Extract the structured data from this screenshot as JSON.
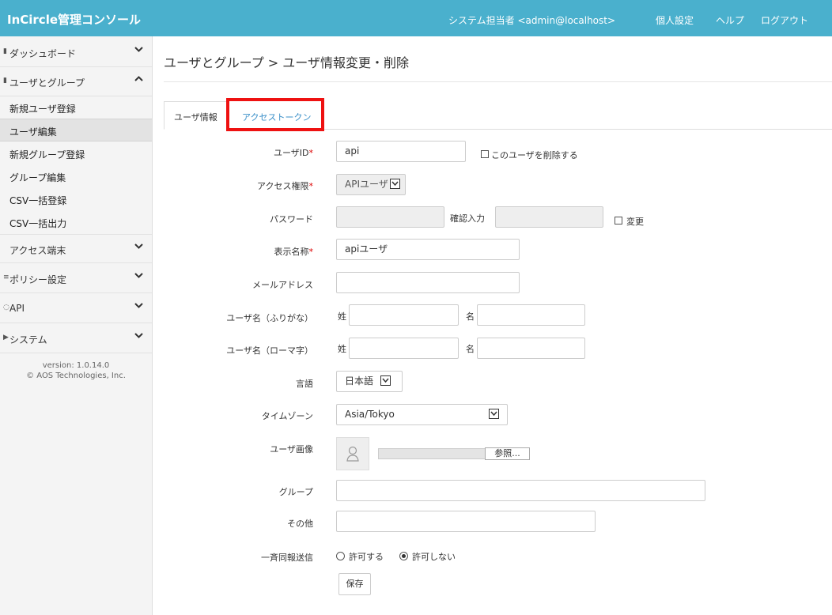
{
  "header": {
    "brand": "InCircle管理コンソール",
    "user": "システム担当者 <admin@localhost>",
    "nav": [
      "個人設定",
      "ヘルプ",
      "ログアウト"
    ]
  },
  "sidebar": {
    "sections": [
      {
        "label": "ダッシュボード",
        "icon": "chart-icon",
        "expanded": false
      },
      {
        "label": "ユーザとグループ",
        "icon": "user-icon",
        "expanded": true
      },
      {
        "label": "アクセス端末",
        "icon": "device-icon",
        "expanded": false
      },
      {
        "label": "ポリシー設定",
        "icon": "list-icon",
        "expanded": false
      },
      {
        "label": "API",
        "icon": "api-icon",
        "expanded": false
      },
      {
        "label": "システム",
        "icon": "play-icon",
        "expanded": false
      }
    ],
    "items": [
      "新規ユーザ登録",
      "ユーザ編集",
      "新規グループ登録",
      "グループ編集",
      "CSV一括登録",
      "CSV一括出力"
    ],
    "active_item": "ユーザ編集",
    "version": "version: 1.0.14.0",
    "copyright": "© AOS Technologies, Inc."
  },
  "page": {
    "title": "ユーザとグループ > ユーザ情報変更・削除",
    "tabs": [
      "ユーザ情報",
      "アクセストークン"
    ]
  },
  "form": {
    "user_id_label": "ユーザID",
    "required_mark": "*",
    "user_id_value": "api",
    "delete_label": "このユーザを削除する",
    "access_label": "アクセス権限",
    "access_value": "APIユーザ",
    "password_label": "パスワード",
    "confirm_label": "確認入力",
    "change_label": "変更",
    "display_label": "表示名称",
    "display_value": "apiユーザ",
    "email_label": "メールアドレス",
    "name_kana_label": "ユーザ名（ふりがな）",
    "name_roma_label": "ユーザ名（ローマ字）",
    "last_label": "姓",
    "first_label": "名",
    "lang_label": "言語",
    "lang_value": "日本語",
    "tz_label": "タイムゾーン",
    "tz_value": "Asia/Tokyo",
    "image_label": "ユーザ画像",
    "browse_label": "参照...",
    "group_label": "グループ",
    "other_label": "その他",
    "broadcast_label": "一斉同報送信",
    "allow_label": "許可する",
    "deny_label": "許可しない",
    "broadcast_selected": "許可しない",
    "save_label": "保存"
  }
}
